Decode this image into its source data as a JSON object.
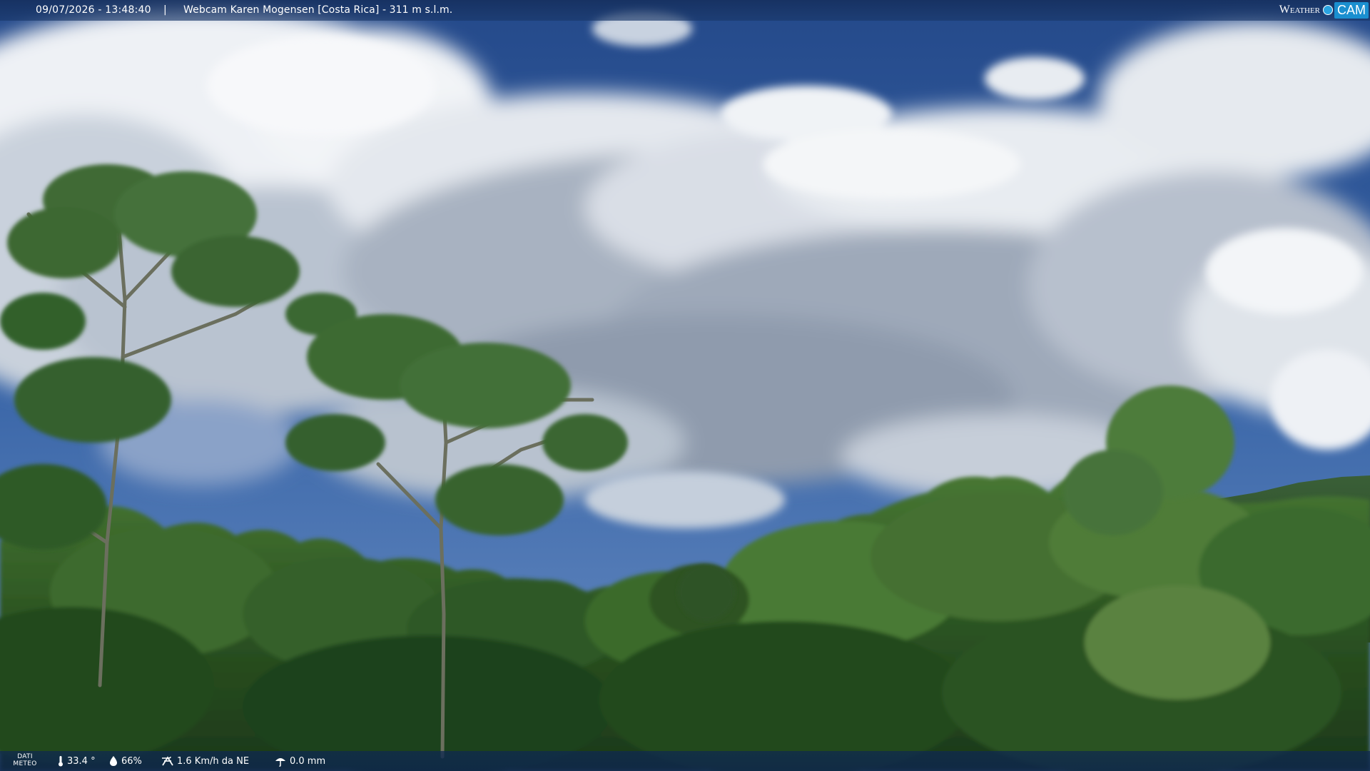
{
  "topbar": {
    "datetime": "09/07/2026 - 13:48:40",
    "separator": "|",
    "camera_title": "Webcam Karen Mogensen [Costa Rica]  - 311 m s.l.m.",
    "logo_weather": "Weather",
    "logo_cam": "CAM"
  },
  "bottombar": {
    "meteo_label_line1": "DATI",
    "meteo_label_line2": "METEO",
    "temperature": "33.4 °",
    "humidity": "66%",
    "wind": "1.6 Km/h da NE",
    "rain": "0.0 mm"
  },
  "icons": {
    "temperature": "thermometer-icon",
    "humidity": "droplet-icon",
    "wind": "wind-icon",
    "rain": "rain-icon"
  },
  "colors": {
    "sky": "#2c5596",
    "cloud": "#e6eaf0",
    "forest": "#2f5a26",
    "bar": "#14305e",
    "logo_accent": "#1a8fd0"
  }
}
